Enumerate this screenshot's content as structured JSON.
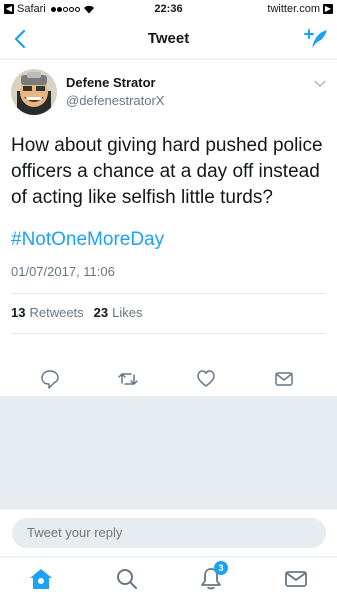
{
  "status_bar": {
    "carrier": "Safari",
    "time": "22:36",
    "url": "twitter.com"
  },
  "nav": {
    "title": "Tweet",
    "back_icon": "chevron-left-icon",
    "compose_icon": "compose-icon"
  },
  "tweet": {
    "author_name": "Defene Strator",
    "author_handle": "@defenestratorX",
    "text": "How about giving hard pushed police officers a chance at a day off instead of acting like selfish little turds?",
    "hashtag": "#NotOneMoreDay",
    "timestamp": "01/07/2017, 11:06",
    "retweets_count": "13",
    "retweets_label": "Retweets",
    "likes_count": "23",
    "likes_label": "Likes"
  },
  "reply": {
    "placeholder": "Tweet your reply"
  },
  "tabbar": {
    "notifications_badge": "3"
  },
  "colors": {
    "accent": "#1da1f2",
    "text": "#14171a",
    "secondary": "#657786",
    "border": "#e1e8ed",
    "background_gray": "#e6ecf0"
  }
}
